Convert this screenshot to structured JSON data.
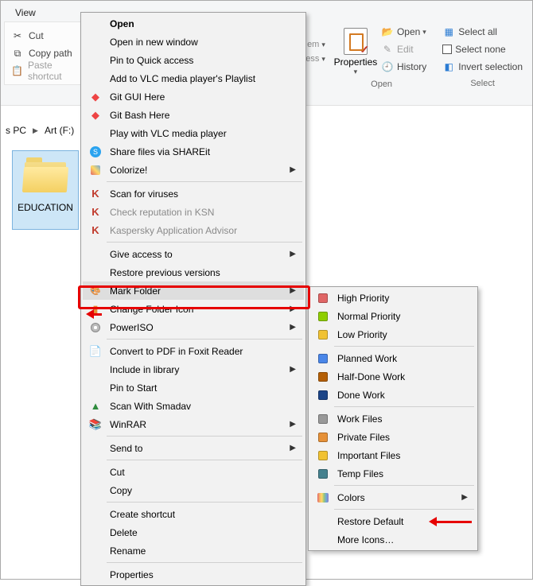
{
  "view_tab": "View",
  "ribbon_left": {
    "cut": "Cut",
    "copy_path": "Copy path",
    "paste_shortcut": "Paste shortcut"
  },
  "partial_col": {
    "a": "em",
    "b": "cess"
  },
  "properties": {
    "label": "Properties",
    "open_group": "Open",
    "open": "Open",
    "edit": "Edit",
    "history": "History"
  },
  "select": {
    "group": "Select",
    "all": "Select all",
    "none": "Select none",
    "invert": "Invert selection"
  },
  "breadcrumb": {
    "pc": "s PC",
    "drive": "Art (F:)"
  },
  "folder_label": "EDUCATION",
  "menu": [
    {
      "label": "Open",
      "bold": true
    },
    {
      "label": "Open in new window"
    },
    {
      "label": "Pin to Quick access"
    },
    {
      "label": "Add to VLC media player's Playlist"
    },
    {
      "label": "Git GUI Here",
      "icon": "git-gui"
    },
    {
      "label": "Git Bash Here",
      "icon": "git-bash"
    },
    {
      "label": "Play with VLC media player"
    },
    {
      "label": "Share files via SHAREit",
      "icon": "shareit"
    },
    {
      "label": "Colorize!",
      "icon": "colorize",
      "submenu": true
    },
    {
      "sep": true
    },
    {
      "label": "Scan for viruses",
      "icon": "kaspersky"
    },
    {
      "label": "Check reputation in KSN",
      "icon": "kaspersky",
      "disabled": true
    },
    {
      "label": "Kaspersky Application Advisor",
      "icon": "kaspersky",
      "disabled": true
    },
    {
      "sep": true
    },
    {
      "label": "Give access to",
      "submenu": true
    },
    {
      "label": "Restore previous versions"
    },
    {
      "label": "Mark Folder",
      "icon": "mark",
      "submenu": true,
      "highlight": true
    },
    {
      "label": "Change Folder Icon",
      "icon": "change-icon",
      "submenu": true
    },
    {
      "label": "PowerISO",
      "icon": "poweriso",
      "submenu": true
    },
    {
      "sep": true
    },
    {
      "label": "Convert to PDF in Foxit Reader",
      "icon": "foxit"
    },
    {
      "label": "Include in library",
      "submenu": true
    },
    {
      "label": "Pin to Start"
    },
    {
      "label": "Scan With Smadav",
      "icon": "smadav"
    },
    {
      "label": "WinRAR",
      "icon": "winrar",
      "submenu": true
    },
    {
      "sep": true
    },
    {
      "label": "Send to",
      "submenu": true
    },
    {
      "sep": true
    },
    {
      "label": "Cut"
    },
    {
      "label": "Copy"
    },
    {
      "sep": true
    },
    {
      "label": "Create shortcut"
    },
    {
      "label": "Delete"
    },
    {
      "label": "Rename"
    },
    {
      "sep": true
    },
    {
      "label": "Properties"
    }
  ],
  "submenu": [
    {
      "label": "High Priority",
      "color": "red"
    },
    {
      "label": "Normal Priority",
      "color": "green"
    },
    {
      "label": "Low Priority",
      "color": "yellow"
    },
    {
      "sep": true
    },
    {
      "label": "Planned Work",
      "color": "blue"
    },
    {
      "label": "Half-Done Work",
      "color": "brown"
    },
    {
      "label": "Done Work",
      "color": "navy"
    },
    {
      "sep": true
    },
    {
      "label": "Work Files",
      "color": "gray"
    },
    {
      "label": "Private Files",
      "color": "orange"
    },
    {
      "label": "Important Files",
      "color": "yellow"
    },
    {
      "label": "Temp Files",
      "color": "teal"
    },
    {
      "sep": true
    },
    {
      "label": "Colors",
      "rainbow": true,
      "submenu": true
    },
    {
      "sep": true
    },
    {
      "label": "Restore Default"
    },
    {
      "label": "More Icons…"
    }
  ]
}
